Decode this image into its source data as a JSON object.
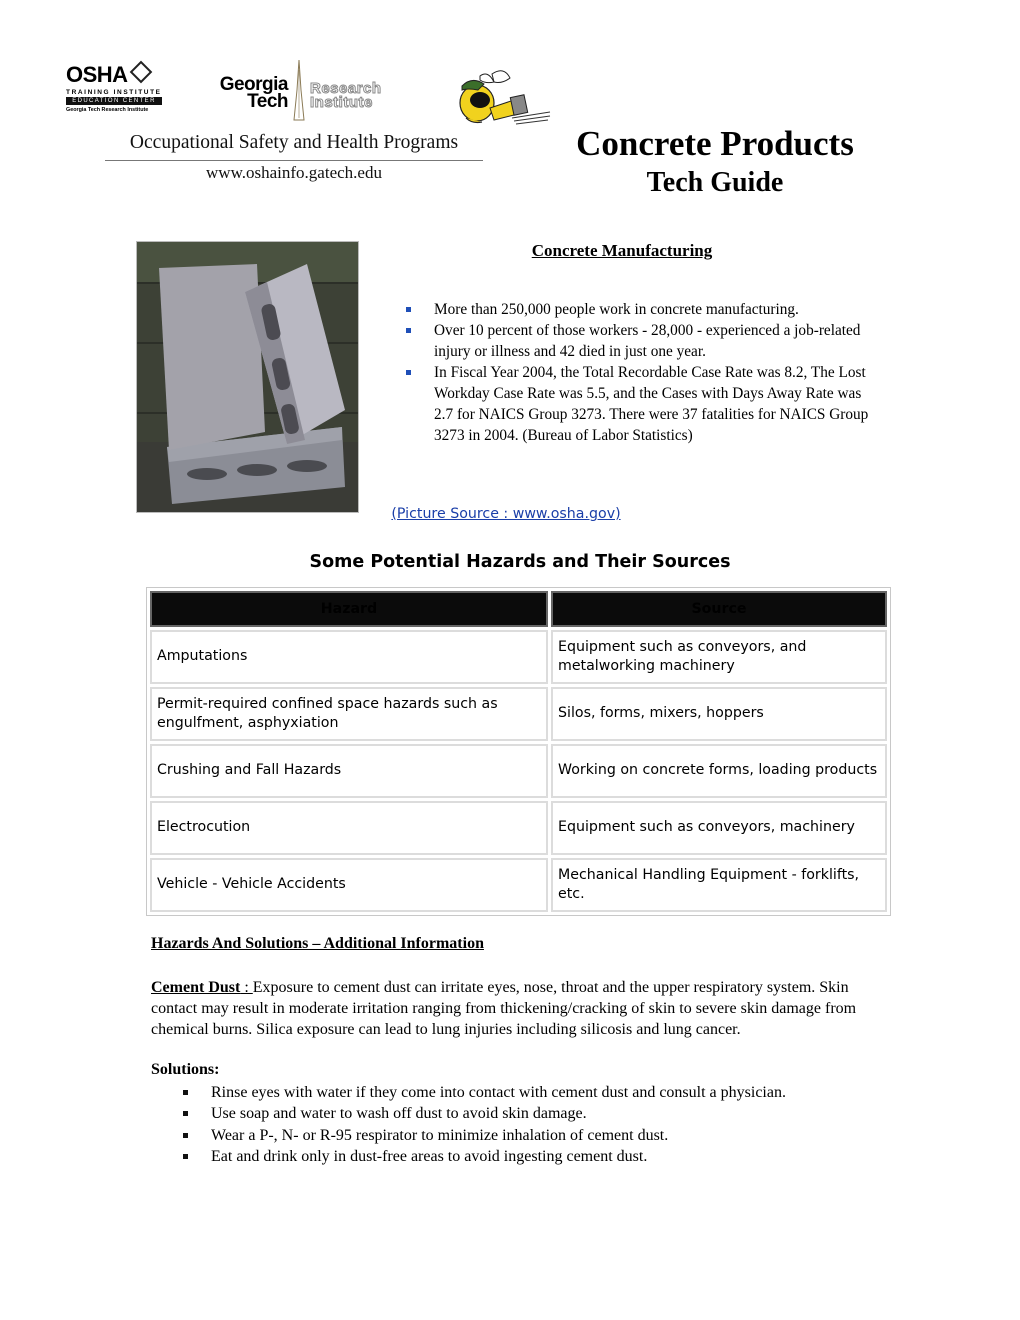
{
  "header": {
    "osha_logo": {
      "main": "OSHA",
      "line1": "TRAINING INSTITUTE",
      "line2": "EDUCATION CENTER",
      "line3": "Georgia Tech Research Institute"
    },
    "gt_logo": {
      "line1": "Georgia",
      "line2": "Tech",
      "ri_line1": "Research",
      "ri_line2": "Institute"
    },
    "mascot_icon": "yellow-jacket-mascot-icon",
    "programs": "Occupational Safety and Health Programs",
    "website": "www.oshainfo.gatech.edu",
    "title": "Concrete Products",
    "subtitle": "Tech Guide"
  },
  "manufacturing": {
    "heading": "Concrete Manufacturing",
    "bullets": [
      "More than 250,000 people work in concrete manufacturing.",
      "Over 10 percent of those workers - 28,000 - experienced a job-related injury or illness and 42 died in just one year.",
      "In Fiscal Year 2004, the Total Recordable Case Rate was 8.2, The Lost Workday Case Rate was 5.5, and the Cases with Days Away Rate was 2.7 for NAICS Group 3273. There were 37 fatalities for NAICS Group 3273 in 2004. (Bureau of Labor Statistics)"
    ],
    "bullet_color": "#1f4fb8",
    "picture_source": "(Picture Source : www.osha.gov)",
    "photo_alt": "Concrete blocks photo"
  },
  "hazards": {
    "heading": "Some Potential Hazards and Their Sources",
    "columns": [
      "Hazard",
      "Source"
    ],
    "rows": [
      [
        "Amputations",
        "Equipment such as conveyors, and metalworking machinery"
      ],
      [
        "Permit-required confined space hazards such as engulfment, asphyxiation",
        "Silos, forms, mixers, hoppers"
      ],
      [
        "Crushing and Fall Hazards",
        "Working on concrete forms, loading products"
      ],
      [
        "Electrocution",
        "Equipment such as conveyors, machinery"
      ],
      [
        "Vehicle - Vehicle Accidents",
        "Mechanical Handling Equipment - forklifts, etc."
      ]
    ]
  },
  "additional": {
    "heading": "Hazards And Solutions – Additional Information",
    "cement_label": "Cement Dust",
    "cement_sep": " : ",
    "cement_text": "Exposure to cement dust can irritate eyes, nose, throat and the upper respiratory system. Skin contact may result in moderate irritation ranging from thickening/cracking of skin to severe skin damage from chemical burns. Silica exposure can lead to lung injuries including silicosis and lung cancer.",
    "solutions_label": "Solutions:",
    "solutions": [
      "Rinse eyes with water if they come into contact with cement dust and consult a physician.",
      "Use soap and water to wash off dust to avoid skin damage.",
      "Wear a P-, N- or R-95 respirator to minimize inhalation of cement dust.",
      "Eat and drink only in dust-free areas to avoid ingesting cement dust."
    ]
  }
}
